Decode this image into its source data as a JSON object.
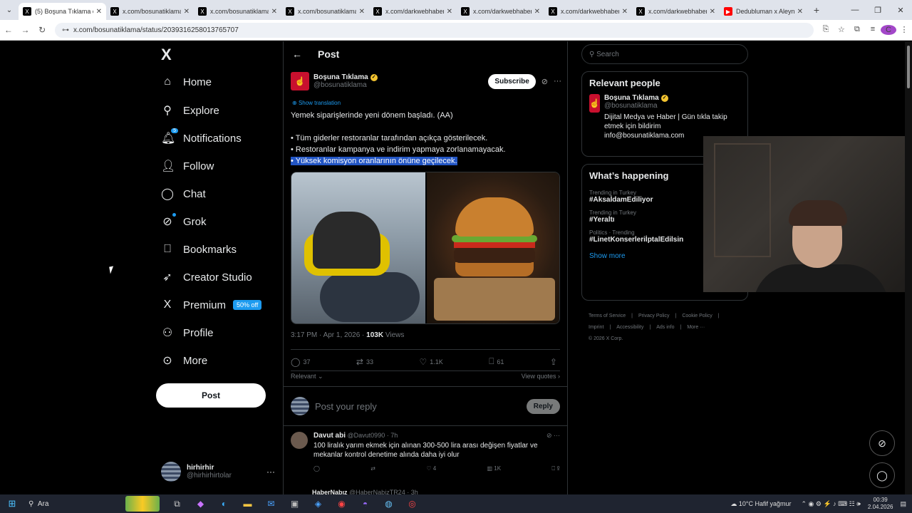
{
  "browser": {
    "tabs": [
      {
        "title": "(5) Boşuna Tıklama o",
        "fav": "X",
        "active": true
      },
      {
        "title": "x.com/bosunatiklama",
        "fav": "X"
      },
      {
        "title": "x.com/bosunatiklama",
        "fav": "X"
      },
      {
        "title": "x.com/bosunatiklama",
        "fav": "X"
      },
      {
        "title": "x.com/darkwebhaber",
        "fav": "X"
      },
      {
        "title": "x.com/darkwebhaber",
        "fav": "X"
      },
      {
        "title": "x.com/darkwebhaber",
        "fav": "X"
      },
      {
        "title": "x.com/darkwebhaber",
        "fav": "X"
      },
      {
        "title": "Dedubluman x Aleyna",
        "fav": "▶",
        "yt": true
      }
    ],
    "url": "x.com/bosunatiklama/status/2039316258013765707",
    "profile_initial": "C"
  },
  "nav": {
    "logo": "X",
    "items": [
      {
        "label": "Home",
        "icon": "home-icon",
        "glyph": "⌂"
      },
      {
        "label": "Explore",
        "icon": "search-icon",
        "glyph": "⚲"
      },
      {
        "label": "Notifications",
        "icon": "bell-icon",
        "glyph": "🔔︎",
        "badge": "5"
      },
      {
        "label": "Follow",
        "icon": "follow-icon",
        "glyph": "👤︎"
      },
      {
        "label": "Chat",
        "icon": "chat-icon",
        "glyph": "◯"
      },
      {
        "label": "Grok",
        "icon": "grok-icon",
        "glyph": "⊘",
        "dot": true
      },
      {
        "label": "Bookmarks",
        "icon": "bookmark-icon",
        "glyph": "⎕"
      },
      {
        "label": "Creator Studio",
        "icon": "rocket-icon",
        "glyph": "➶"
      },
      {
        "label": "Premium",
        "icon": "x-premium-icon",
        "glyph": "X",
        "promo": "50% off"
      },
      {
        "label": "Profile",
        "icon": "profile-icon",
        "glyph": "⚇"
      },
      {
        "label": "More",
        "icon": "more-icon",
        "glyph": "⊙"
      }
    ],
    "post_button": "Post",
    "account": {
      "name": "hirhirhir",
      "handle": "@hirhirhirtolar",
      "more": "···"
    }
  },
  "post": {
    "header_title": "Post",
    "author_name": "Boşuna Tıklama",
    "author_handle": "@bosunatiklama",
    "subscribe": "Subscribe",
    "show_translation": "Show translation",
    "lines": [
      "Yemek siparişlerinde yeni dönem başladı. (AA)",
      "",
      "• Tüm giderler restoranlar tarafından açıkça gösterilecek.",
      "• Restoranlar kampanya ve indirim yapmaya zorlanamayacak."
    ],
    "highlighted_line": "• Yüksek komisyon oranlarının önüne geçilecek.",
    "time": "3:17 PM · Apr 1, 2026 · ",
    "views_count": "103K",
    "views_label": " Views",
    "stats": {
      "replies": "37",
      "reposts": "33",
      "likes": "1.1K",
      "bookmarks": "61"
    },
    "sort": "Relevant ⌄",
    "view_quotes": "View quotes ›",
    "reply_placeholder": "Post your reply",
    "reply_button": "Reply"
  },
  "replies": [
    {
      "name": "Davut abi",
      "meta": "@Davut0990 · 7h",
      "text": "100 liralık yarım ekmek için alınan 300-500 lira arası değişen fiyatlar ve mekanlar kontrol denetime alında daha iyi olur",
      "likes": "4",
      "views": "1K"
    }
  ],
  "reply2": {
    "name": "HaberNabız",
    "meta": "@HaberNabizTR24 · 3h"
  },
  "sidebar": {
    "search_placeholder": "Search",
    "relevant_title": "Relevant people",
    "person": {
      "name": "Boşuna Tıklama",
      "handle": "@bosunatiklama",
      "bio": "Dijital Medya ve Haber | Gün tıkla takip etmek için bildirim info@bosunatiklama.com"
    },
    "happening_title": "What’s happening",
    "trends": [
      {
        "category": "Trending in Turkey",
        "tag": "#AksaİdamEdiliyor"
      },
      {
        "category": "Trending in Turkey",
        "tag": "#Yeraltı"
      },
      {
        "category": "Politics · Trending",
        "tag": "#LinetKonserleriİptalEdilsin"
      }
    ],
    "show_more": "Show more",
    "footer": [
      "Terms of Service",
      "|",
      "Privacy Policy",
      "|",
      "Cookie Policy",
      "|",
      "Imprint",
      "|",
      "Accessibility",
      "|",
      "Ads info",
      "|",
      "More ···",
      "© 2026 X Corp."
    ]
  },
  "taskbar": {
    "search": "Ara",
    "weather": "10°C  Hafif yağmur",
    "time": "00:39",
    "date": "2.04.2026"
  },
  "colors": {
    "accent": "#1d9bf0",
    "highlight": "#2255c4",
    "background": "#000000"
  }
}
